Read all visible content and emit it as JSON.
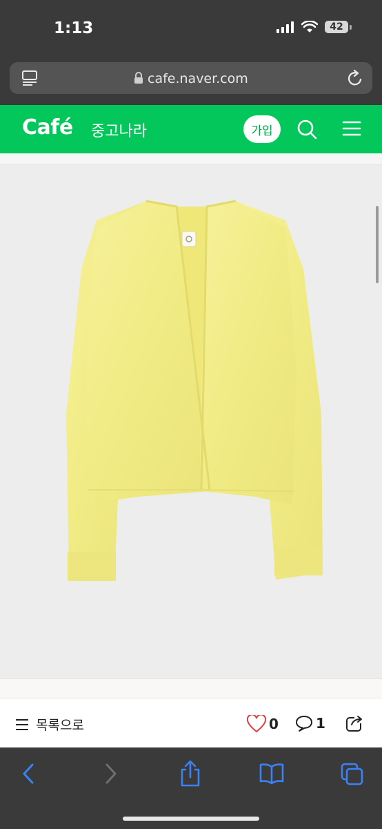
{
  "status_bar": {
    "time": "1:13",
    "battery": "42"
  },
  "browser": {
    "url": "cafe.naver.com"
  },
  "cafe": {
    "logo": "Café",
    "name": "중고나라",
    "join_label": "가입"
  },
  "product": {
    "image_alt": "yellow knit cardigan",
    "image_color": "#f3ee8a",
    "background": "#ededed"
  },
  "toolbar": {
    "list_label": "목록으로",
    "like_count": "0",
    "comment_count": "1"
  },
  "colors": {
    "brand": "#03c75a",
    "safari_accent": "#3b82f6",
    "safari_disabled": "#6f6f6f",
    "like": "#e03c3c"
  },
  "icons": {
    "reader": "reader-mode-icon",
    "lock": "lock-icon",
    "reload": "reload-icon",
    "search": "search-icon",
    "menu": "hamburger-menu-icon",
    "list": "list-icon",
    "like": "heart-icon",
    "comment": "speech-bubble-icon",
    "share": "share-icon",
    "back": "chevron-left-icon",
    "forward": "chevron-right-icon",
    "safari_share": "share-up-icon",
    "bookmarks": "book-icon",
    "tabs": "tabs-icon"
  }
}
